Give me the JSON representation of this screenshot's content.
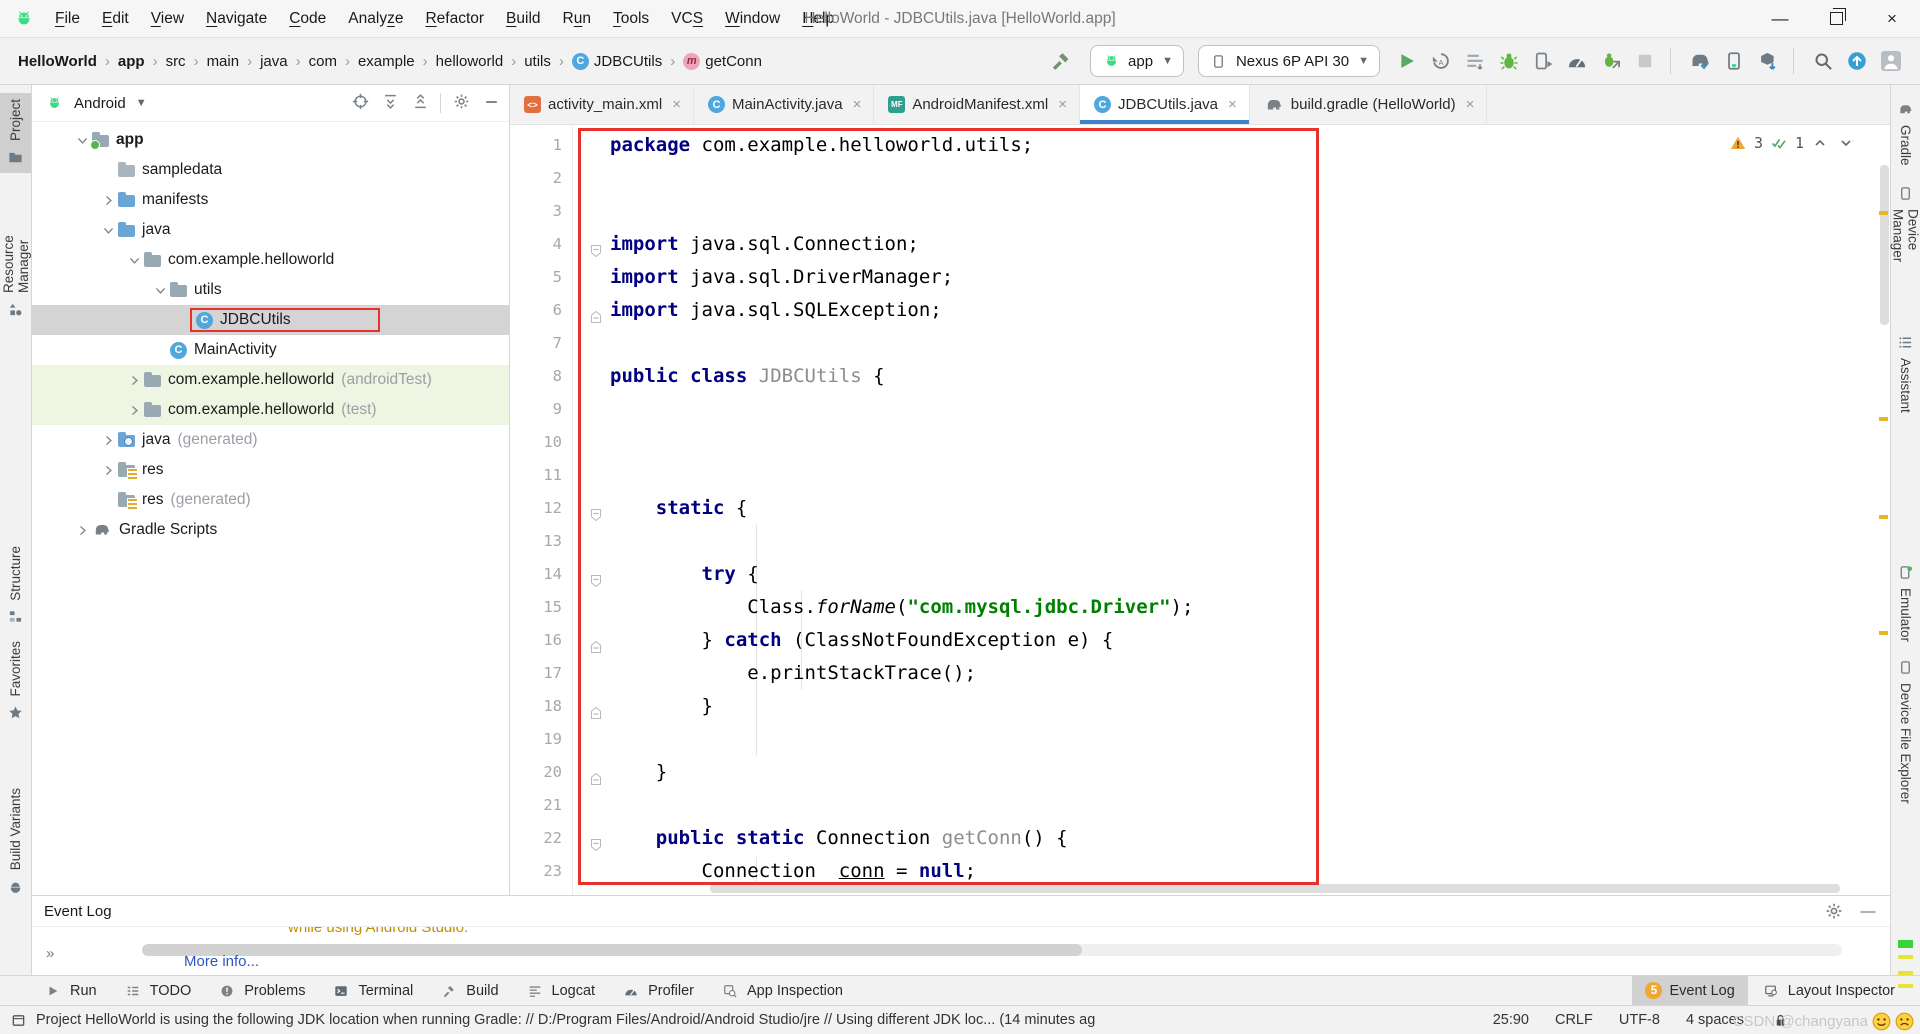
{
  "window": {
    "title": "HelloWorld - JDBCUtils.java [HelloWorld.app]"
  },
  "menubar": {
    "items": [
      {
        "label": "File",
        "mn": 0
      },
      {
        "label": "Edit",
        "mn": 0
      },
      {
        "label": "View",
        "mn": 0
      },
      {
        "label": "Navigate",
        "mn": 0
      },
      {
        "label": "Code",
        "mn": 0
      },
      {
        "label": "Analyze",
        "mn": 5
      },
      {
        "label": "Refactor",
        "mn": 0
      },
      {
        "label": "Build",
        "mn": 0
      },
      {
        "label": "Run",
        "mn": 1
      },
      {
        "label": "Tools",
        "mn": 0
      },
      {
        "label": "VCS",
        "mn": 2
      },
      {
        "label": "Window",
        "mn": 0
      },
      {
        "label": "Help",
        "mn": 0
      }
    ]
  },
  "breadcrumbs": {
    "separator": "›",
    "items": [
      {
        "label": "HelloWorld",
        "bold": true
      },
      {
        "label": "app",
        "bold": true
      },
      {
        "label": "src"
      },
      {
        "label": "main"
      },
      {
        "label": "java"
      },
      {
        "label": "com"
      },
      {
        "label": "example"
      },
      {
        "label": "helloworld"
      },
      {
        "label": "utils"
      },
      {
        "label": "JDBCUtils",
        "icon": "class"
      },
      {
        "label": "getConn",
        "icon": "method"
      }
    ]
  },
  "run_config": {
    "module": "app",
    "device": "Nexus 6P API 30"
  },
  "toolbar_icons": {
    "run_group": [
      "run-play",
      "apply-changes",
      "apply-code-changes",
      "debug-bug",
      "attach-process",
      "profiler-gauge",
      "attach-debugger",
      "stop"
    ],
    "manage_group": [
      "gradle-sync",
      "device-manager",
      "sdk-manager"
    ],
    "far_group": [
      "search-everywhere",
      "ide-updates",
      "user-avatar"
    ]
  },
  "project_panel": {
    "view": "Android",
    "header_icons": [
      "select-opened-file",
      "expand-all",
      "collapse-all",
      "divider",
      "settings-gear",
      "hide-panel"
    ],
    "tree": [
      {
        "level": 0,
        "chev": "down",
        "icon": "f-app",
        "label": "app",
        "bold": true
      },
      {
        "level": 1,
        "chev": "none",
        "icon": "f-gray",
        "label": "sampledata"
      },
      {
        "level": 1,
        "chev": "right",
        "icon": "f-blue",
        "label": "manifests"
      },
      {
        "level": 1,
        "chev": "down",
        "icon": "f-blue",
        "label": "java"
      },
      {
        "level": 2,
        "chev": "down",
        "icon": "f-pkg",
        "label": "com.example.helloworld"
      },
      {
        "level": 3,
        "chev": "down",
        "icon": "f-pkg",
        "label": "utils"
      },
      {
        "level": 4,
        "chev": "none",
        "icon": "class",
        "label": "JDBCUtils",
        "selected": true,
        "redbox": true
      },
      {
        "level": 3,
        "chev": "none",
        "icon": "class",
        "label": "MainActivity"
      },
      {
        "level": 2,
        "chev": "right",
        "icon": "f-pkg",
        "label": "com.example.helloworld",
        "ann": "(androidTest)",
        "green": true
      },
      {
        "level": 2,
        "chev": "right",
        "icon": "f-pkg",
        "label": "com.example.helloworld",
        "ann": "(test)",
        "green": true
      },
      {
        "level": 1,
        "chev": "right",
        "icon": "f-gen",
        "label": "java",
        "ann": "(generated)"
      },
      {
        "level": 1,
        "chev": "right",
        "icon": "f-res",
        "label": "res"
      },
      {
        "level": 1,
        "chev": "none",
        "icon": "f-res",
        "label": "res",
        "ann": "(generated)"
      },
      {
        "level": 0,
        "chev": "right",
        "icon": "gradle",
        "label": "Gradle Scripts"
      }
    ]
  },
  "tabs": [
    {
      "icon": "xml",
      "label": "activity_main.xml"
    },
    {
      "icon": "class",
      "label": "MainActivity.java"
    },
    {
      "icon": "mf",
      "label": "AndroidManifest.xml"
    },
    {
      "icon": "class",
      "label": "JDBCUtils.java",
      "active": true
    },
    {
      "icon": "gradle",
      "label": "build.gradle (HelloWorld)"
    }
  ],
  "editor": {
    "inspections": {
      "warnings": "3",
      "ok": "1"
    },
    "folds": {
      "4": "start",
      "6": "end",
      "12": "start",
      "14": "start",
      "16": "end",
      "18": "end",
      "20": "end",
      "22": "start"
    },
    "lines": [
      [
        [
          "k",
          "package"
        ],
        [
          "p",
          " com.example.helloworld.utils;"
        ]
      ],
      [],
      [],
      [
        [
          "k",
          "import"
        ],
        [
          "p",
          " java.sql.Connection;"
        ]
      ],
      [
        [
          "k",
          "import"
        ],
        [
          "p",
          " java.sql.DriverManager;"
        ]
      ],
      [
        [
          "k",
          "import"
        ],
        [
          "p",
          " java.sql.SQLException;"
        ]
      ],
      [],
      [
        [
          "k",
          "public"
        ],
        [
          "p",
          " "
        ],
        [
          "k",
          "class"
        ],
        [
          "p",
          " "
        ],
        [
          "g",
          "JDBCUtils"
        ],
        [
          "p",
          " {"
        ]
      ],
      [],
      [],
      [],
      [
        [
          "p",
          "    "
        ],
        [
          "k",
          "static"
        ],
        [
          "p",
          " {"
        ]
      ],
      [],
      [
        [
          "p",
          "        "
        ],
        [
          "k",
          "try"
        ],
        [
          "p",
          " {"
        ]
      ],
      [
        [
          "p",
          "            Class."
        ],
        [
          "i",
          "forName"
        ],
        [
          "p",
          "("
        ],
        [
          "s",
          "\"com.mysql.jdbc.Driver\""
        ],
        [
          "p",
          ");"
        ]
      ],
      [
        [
          "p",
          "        } "
        ],
        [
          "k",
          "catch"
        ],
        [
          "p",
          " (ClassNotFoundException e) {"
        ]
      ],
      [
        [
          "p",
          "            e.printStackTrace();"
        ]
      ],
      [
        [
          "p",
          "        }"
        ]
      ],
      [],
      [
        [
          "p",
          "    }"
        ]
      ],
      [],
      [
        [
          "p",
          "    "
        ],
        [
          "k",
          "public"
        ],
        [
          "p",
          " "
        ],
        [
          "k",
          "static"
        ],
        [
          "p",
          " Connection "
        ],
        [
          "g",
          "getConn"
        ],
        [
          "p",
          "() {"
        ]
      ],
      [
        [
          "p",
          "        Connection  "
        ],
        [
          "u",
          "conn"
        ],
        [
          "p",
          " = "
        ],
        [
          "k",
          "null"
        ],
        [
          "p",
          ";"
        ]
      ]
    ]
  },
  "left_stripe": [
    {
      "label": "Project",
      "icon": "folder-tool",
      "selected": true
    },
    {
      "label": "Resource Manager",
      "icon": "shapes"
    },
    {
      "label": "Structure",
      "icon": "structure"
    },
    {
      "label": "Favorites",
      "icon": "star"
    },
    {
      "label": "Build Variants",
      "icon": "android-tool"
    }
  ],
  "right_stripe": [
    {
      "label": "Gradle",
      "icon": "gradle"
    },
    {
      "label": "Device Manager",
      "icon": "phone-tool"
    },
    {
      "label": "Assistant",
      "icon": "list-tool"
    },
    {
      "label": "Emulator",
      "icon": "phone-green"
    },
    {
      "label": "Device File Explorer",
      "icon": "phone-tool"
    }
  ],
  "event_log": {
    "title": "Event Log",
    "clipped_line": "while using Android Studio.",
    "link": "More info...",
    "overflow_chevron": "»"
  },
  "bottom_bar": {
    "left": [
      {
        "icon": "play-gray",
        "label": "Run"
      },
      {
        "icon": "todo-list",
        "label": "TODO"
      },
      {
        "icon": "problems",
        "label": "Problems"
      },
      {
        "icon": "terminal",
        "label": "Terminal"
      },
      {
        "icon": "build-hammer",
        "label": "Build"
      },
      {
        "icon": "logcat",
        "label": "Logcat"
      },
      {
        "icon": "profiler-gauge",
        "label": "Profiler"
      },
      {
        "icon": "app-inspection",
        "label": "App Inspection"
      }
    ],
    "right": [
      {
        "badge": "5",
        "label": "Event Log",
        "active": true
      },
      {
        "icon": "layout-inspector",
        "label": "Layout Inspector"
      }
    ]
  },
  "status_bar": {
    "message": "Project HelloWorld is using the following JDK location when running Gradle: // D:/Program Files/Android/Android Studio/jre // Using different JDK loc... (14 minutes ag",
    "position": "25:90",
    "line_ending": "CRLF",
    "encoding": "UTF-8",
    "indent": "4 spaces"
  },
  "watermark": {
    "text": "CSDN @changyana"
  }
}
